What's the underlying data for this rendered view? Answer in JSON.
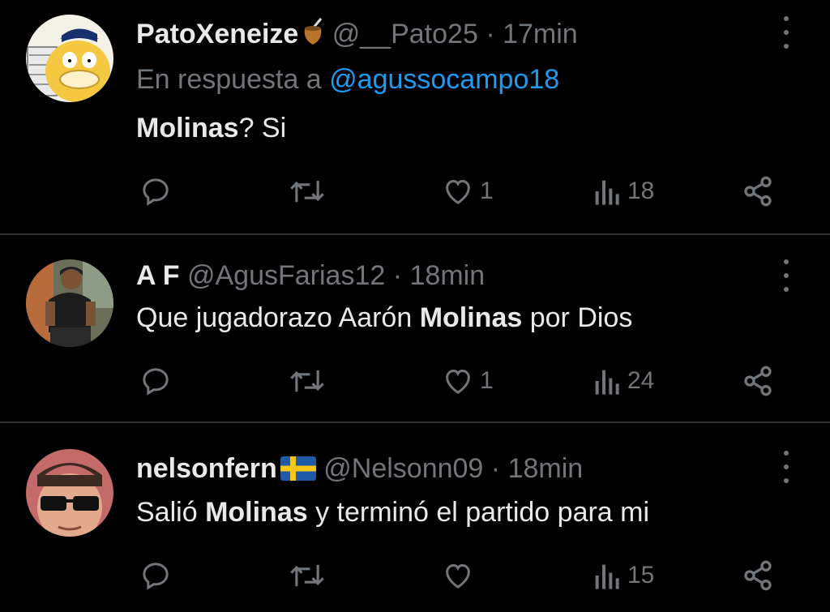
{
  "tweets": [
    {
      "name": "PatoXeneize",
      "name_emoji_icon": "mate-icon",
      "handle": "@__Pato25",
      "sep": "·",
      "time": "17min",
      "reply_prefix": "En respuesta a",
      "reply_mention": "@agussocampo18",
      "text": [
        {
          "bold": true,
          "t": "Molinas"
        },
        {
          "bold": false,
          "t": "? Si"
        }
      ],
      "replies": "",
      "retweets": "",
      "likes": "1",
      "views": "18"
    },
    {
      "name": "A F",
      "handle": "@AgusFarias12",
      "sep": "·",
      "time": "18min",
      "text": [
        {
          "bold": false,
          "t": "Que jugadorazo Aarón "
        },
        {
          "bold": true,
          "t": "Molinas"
        },
        {
          "bold": false,
          "t": " por Dios"
        }
      ],
      "replies": "",
      "retweets": "",
      "likes": "1",
      "views": "24"
    },
    {
      "name": "nelsonfern",
      "name_emoji_icon": "sweden-flag-icon",
      "handle": "@Nelsonn09",
      "sep": "·",
      "time": "18min",
      "text": [
        {
          "bold": false,
          "t": "Salió "
        },
        {
          "bold": true,
          "t": "Molinas"
        },
        {
          "bold": false,
          "t": " y terminó el partido para mi"
        }
      ],
      "replies": "",
      "retweets": "",
      "likes": "",
      "views": "15"
    }
  ],
  "colors": {
    "background": "#000000",
    "primary_text": "#e7e9ea",
    "secondary_text": "#71767b",
    "mention": "#1d9bf0",
    "divider": "#2f3336"
  }
}
